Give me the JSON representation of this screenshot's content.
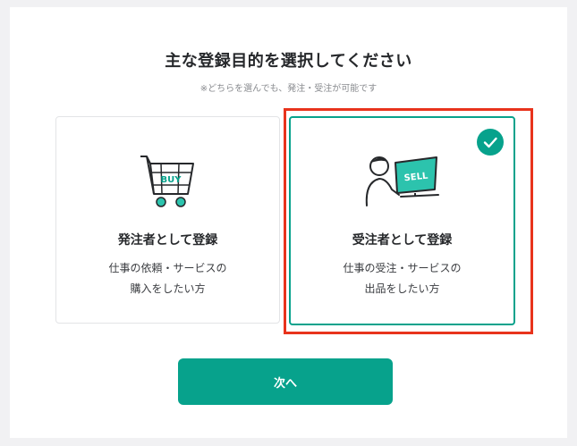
{
  "heading": "主な登録目的を選択してください",
  "note": "※どちらを選んでも、発注・受注が可能です",
  "options": [
    {
      "title": "発注者として登録",
      "desc_line1": "仕事の依頼・サービスの",
      "desc_line2": "購入をしたい方",
      "illustration_label": "BUY",
      "selected": false
    },
    {
      "title": "受注者として登録",
      "desc_line1": "仕事の受注・サービスの",
      "desc_line2": "出品をしたい方",
      "illustration_label": "SELL",
      "selected": true
    }
  ],
  "next_button": "次へ",
  "colors": {
    "accent": "#07a28c",
    "highlight": "#e8331c",
    "text": "#26282b",
    "muted": "#8a8c90"
  }
}
